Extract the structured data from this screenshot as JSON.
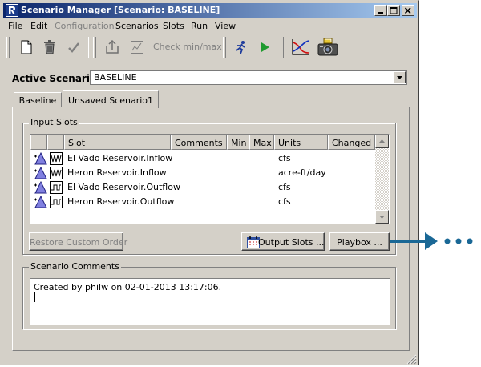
{
  "window": {
    "title": "Scenario Manager [Scenario: BASELINE]"
  },
  "menu": [
    "File",
    "Edit",
    "Configuration",
    "Scenarios",
    "Slots",
    "Run",
    "View"
  ],
  "toolbar": {
    "check_label": "Check min/max"
  },
  "active_scenario": {
    "label": "Active Scenario:",
    "value": "BASELINE"
  },
  "tabs": [
    {
      "label": "Baseline",
      "selected": false
    },
    {
      "label": "Unsaved Scenario1",
      "selected": true
    }
  ],
  "input_slots": {
    "title": "Input Slots",
    "columns": [
      "Slot",
      "Comments",
      "Min",
      "Max",
      "Units",
      "Changed"
    ],
    "rows": [
      {
        "slot": "El Vado Reservoir.Inflow",
        "comments": "",
        "min": "",
        "max": "",
        "units": "cfs",
        "changed": ""
      },
      {
        "slot": "Heron Reservoir.Inflow",
        "comments": "",
        "min": "",
        "max": "",
        "units": "acre-ft/day",
        "changed": ""
      },
      {
        "slot": "El Vado Reservoir.Outflow",
        "comments": "",
        "min": "",
        "max": "",
        "units": "cfs",
        "changed": ""
      },
      {
        "slot": "Heron Reservoir.Outflow",
        "comments": "",
        "min": "",
        "max": "",
        "units": "cfs",
        "changed": ""
      }
    ]
  },
  "buttons": {
    "restore": "Restore Custom Order",
    "output_slots": "Output Slots ...",
    "playbox": "Playbox ..."
  },
  "scenario_comments": {
    "title": "Scenario Comments",
    "text": "Created by philw on 02-01-2013 13:17:06."
  },
  "colors": {
    "title_start": "#0a246a",
    "title_end": "#a6caf0",
    "window_bg": "#d4d0c8",
    "callout_arrow": "#1a6896"
  }
}
